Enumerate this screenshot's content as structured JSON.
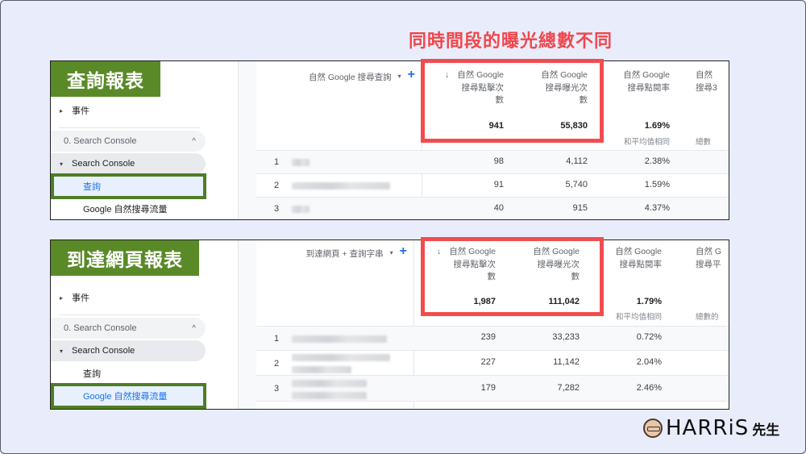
{
  "headline": "同時間段的曝光總數不同",
  "colors": {
    "background": "#e9edfb",
    "headline_red": "#f0474b",
    "badge_green": "#5a8a28",
    "highlight_green": "#4f7d26",
    "red_box": "#f24c4e",
    "active_blue": "#1a73e8"
  },
  "panels": [
    {
      "badge": "查詢報表",
      "sidebar": {
        "top_item": "事件",
        "group": "0. Search Console",
        "sub": "Search Console",
        "leaves": [
          "查詢",
          "Google 自然搜尋流量"
        ],
        "active_leaf": "查詢"
      },
      "dimension_header": "自然 Google 搜尋查詢",
      "columns": [
        {
          "header_line1": "自然 Google",
          "header_line2": "搜尋點擊次",
          "header_line3": "數",
          "sorted": true,
          "total": "941",
          "sub": ""
        },
        {
          "header_line1": "自然 Google",
          "header_line2": "搜尋曝光次",
          "header_line3": "數",
          "sorted": false,
          "total": "55,830",
          "sub": ""
        },
        {
          "header_line1": "自然 Google",
          "header_line2": "搜尋點閱率",
          "header_line3": "",
          "sorted": false,
          "total": "1.69%",
          "sub": "和平均值相同"
        },
        {
          "header_line1": "自然",
          "header_line2": "搜尋3",
          "header_line3": "",
          "sorted": false,
          "total": "",
          "sub": "總數"
        }
      ],
      "rows": [
        {
          "index": "1",
          "clicks": "98",
          "impressions": "4,112",
          "ctr": "2.38%"
        },
        {
          "index": "2",
          "clicks": "91",
          "impressions": "5,740",
          "ctr": "1.59%"
        },
        {
          "index": "3",
          "clicks": "40",
          "impressions": "915",
          "ctr": "4.37%"
        }
      ]
    },
    {
      "badge": "到達網頁報表",
      "sidebar": {
        "top_item": "事件",
        "group": "0. Search Console",
        "sub": "Search Console",
        "leaves": [
          "查詢",
          "Google 自然搜尋流量"
        ],
        "active_leaf": "Google 自然搜尋流量"
      },
      "dimension_header": "到達網頁 + 查詢字串",
      "columns": [
        {
          "header_line1": "自然 Google",
          "header_line2": "搜尋點擊次",
          "header_line3": "數",
          "sorted": true,
          "total": "1,987",
          "sub": ""
        },
        {
          "header_line1": "自然 Google",
          "header_line2": "搜尋曝光次",
          "header_line3": "數",
          "sorted": false,
          "total": "111,042",
          "sub": ""
        },
        {
          "header_line1": "自然 Google",
          "header_line2": "搜尋點閱率",
          "header_line3": "",
          "sorted": false,
          "total": "1.79%",
          "sub": "和平均值相同"
        },
        {
          "header_line1": "自然 G",
          "header_line2": "搜尋平",
          "header_line3": "",
          "sorted": false,
          "total": "",
          "sub": "總數的"
        }
      ],
      "rows": [
        {
          "index": "1",
          "clicks": "239",
          "impressions": "33,233",
          "ctr": "0.72%"
        },
        {
          "index": "2",
          "clicks": "227",
          "impressions": "11,142",
          "ctr": "2.04%"
        },
        {
          "index": "3",
          "clicks": "179",
          "impressions": "7,282",
          "ctr": "2.46%"
        }
      ]
    }
  ],
  "logo": {
    "brand": "HARRiS",
    "suffix": "先生"
  },
  "icons": {
    "sort": "↓",
    "dropdown": "▾",
    "add": "+",
    "expand": "▸",
    "collapse": "▾",
    "chevron_up": "^"
  }
}
